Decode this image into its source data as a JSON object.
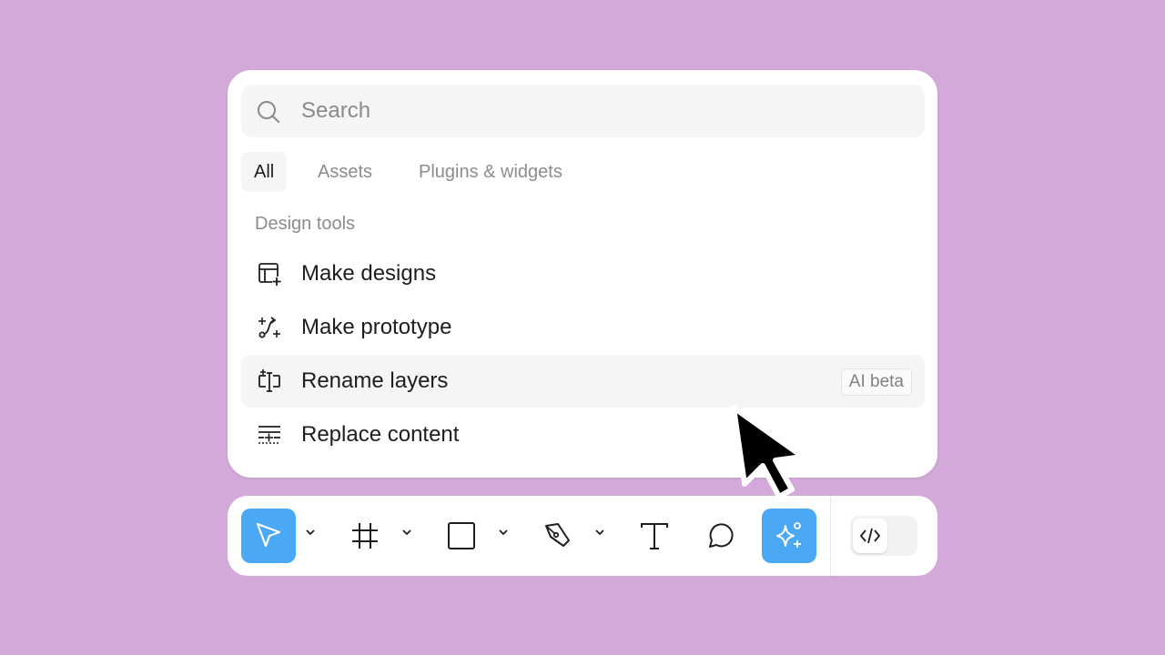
{
  "search": {
    "placeholder": "Search",
    "value": ""
  },
  "tabs": [
    {
      "label": "All",
      "active": true
    },
    {
      "label": "Assets",
      "active": false
    },
    {
      "label": "Plugins & widgets",
      "active": false
    }
  ],
  "section": {
    "title": "Design tools"
  },
  "items": [
    {
      "label": "Make designs",
      "icon": "layout-plus-icon"
    },
    {
      "label": "Make prototype",
      "icon": "prototype-flow-icon"
    },
    {
      "label": "Rename layers",
      "icon": "rename-text-cursor-icon",
      "badge": "AI beta",
      "hovered": true
    },
    {
      "label": "Replace content",
      "icon": "replace-lines-icon"
    }
  ],
  "toolbar": {
    "tools": [
      {
        "name": "move",
        "icon": "move-arrow-icon",
        "active": true
      },
      {
        "name": "frame",
        "icon": "frame-hash-icon"
      },
      {
        "name": "rectangle",
        "icon": "rectangle-icon"
      },
      {
        "name": "pen",
        "icon": "pen-nib-icon"
      },
      {
        "name": "text",
        "icon": "text-t-icon"
      },
      {
        "name": "comment",
        "icon": "comment-bubble-icon"
      },
      {
        "name": "actions",
        "icon": "sparkle-ai-icon",
        "active": true
      }
    ],
    "dev_mode": {
      "icon": "code-brackets-icon",
      "enabled": false
    }
  },
  "colors": {
    "background": "#d2a9d8",
    "accent": "#4aa8f5",
    "panel": "#ffffff"
  }
}
